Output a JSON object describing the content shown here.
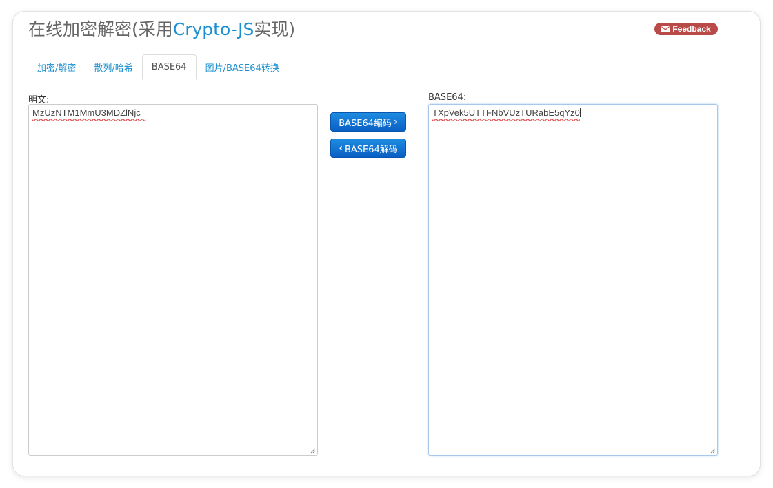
{
  "header": {
    "title_prefix": "在线加密解密(采用",
    "title_highlight": "Crypto-JS",
    "title_suffix": "实现)",
    "feedback_label": "Feedback"
  },
  "tabs": [
    {
      "label": "加密/解密",
      "active": false
    },
    {
      "label": "散列/哈希",
      "active": false
    },
    {
      "label": "BASE64",
      "active": true
    },
    {
      "label": "图片/BASE64转换",
      "active": false
    }
  ],
  "plain": {
    "label": "明文:",
    "value": "MzUzNTM1MmU3MDZlNjc="
  },
  "base64": {
    "label": "BASE64:",
    "value": "TXpVek5UTTFNbVUzTURabE5qYz0"
  },
  "buttons": {
    "encode_label": "BASE64编码",
    "encode_chevron": "›",
    "decode_label": "BASE64解码",
    "decode_chevron": "‹"
  },
  "colors": {
    "accent": "#1a8fd1",
    "button_primary": "#0a6fd6",
    "feedback_bg": "#b94a48",
    "title_text": "#666666"
  }
}
